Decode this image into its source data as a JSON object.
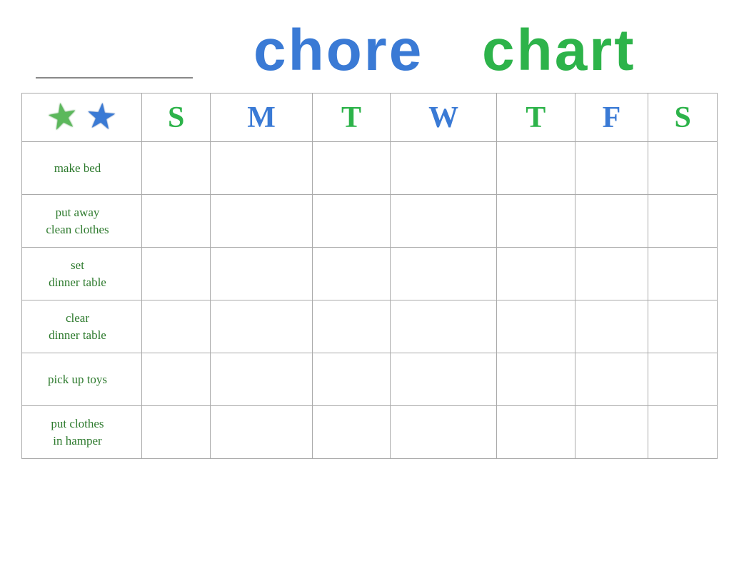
{
  "header": {
    "title_word1": "chore",
    "title_word2": "chart",
    "name_line_placeholder": ""
  },
  "days": {
    "headers": [
      "S",
      "M",
      "T",
      "W",
      "T",
      "F",
      "S"
    ],
    "colors": [
      "green",
      "blue",
      "green",
      "blue",
      "green",
      "blue",
      "green"
    ]
  },
  "chores": [
    {
      "label": "make bed",
      "multiline": false
    },
    {
      "label": "put away\nclean clothes",
      "multiline": true
    },
    {
      "label": "set\ndinner table",
      "multiline": true
    },
    {
      "label": "clear\ndinner table",
      "multiline": true
    },
    {
      "label": "pick up toys",
      "multiline": false
    },
    {
      "label": "put clothes\nin hamper",
      "multiline": true
    }
  ],
  "stars": {
    "green_star": "★",
    "blue_star": "★"
  },
  "colors": {
    "green": "#2db34a",
    "blue": "#3a7ad5",
    "table_border": "#999999"
  }
}
